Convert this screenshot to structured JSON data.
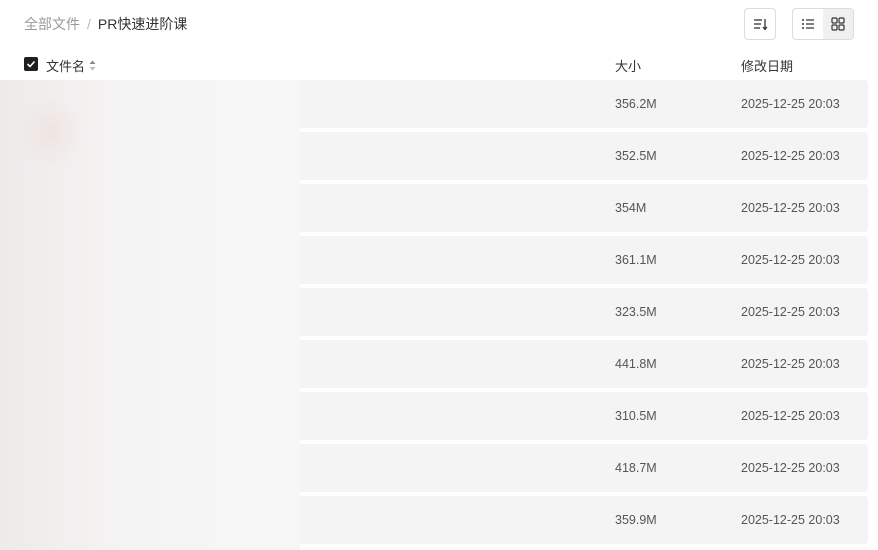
{
  "breadcrumb": {
    "root": "全部文件",
    "separator": "/",
    "current": "PR快速进阶课"
  },
  "toolbar": {
    "sort_icon": "sort-lines-icon",
    "list_view_icon": "list-view-icon",
    "grid_view_icon": "grid-view-icon"
  },
  "table": {
    "headers": {
      "name": "文件名",
      "size": "大小",
      "modified": "修改日期"
    },
    "select_all_checked": true,
    "rows": [
      {
        "name": "",
        "size": "356.2M",
        "modified": "2025-12-25 20:03"
      },
      {
        "name": "",
        "size": "352.5M",
        "modified": "2025-12-25 20:03"
      },
      {
        "name": "",
        "size": "354M",
        "modified": "2025-12-25 20:03"
      },
      {
        "name": "",
        "size": "361.1M",
        "modified": "2025-12-25 20:03"
      },
      {
        "name": "",
        "size": "323.5M",
        "modified": "2025-12-25 20:03"
      },
      {
        "name": "",
        "size": "441.8M",
        "modified": "2025-12-25 20:03"
      },
      {
        "name": "",
        "size": "310.5M",
        "modified": "2025-12-25 20:03"
      },
      {
        "name": "",
        "size": "418.7M",
        "modified": "2025-12-25 20:03"
      },
      {
        "name": "",
        "size": "359.9M",
        "modified": "2025-12-25 20:03"
      }
    ]
  },
  "colors": {
    "row_bg": "#f4f4f4",
    "checkbox": "#1f1f1f",
    "muted_text": "#9a9a9a"
  }
}
